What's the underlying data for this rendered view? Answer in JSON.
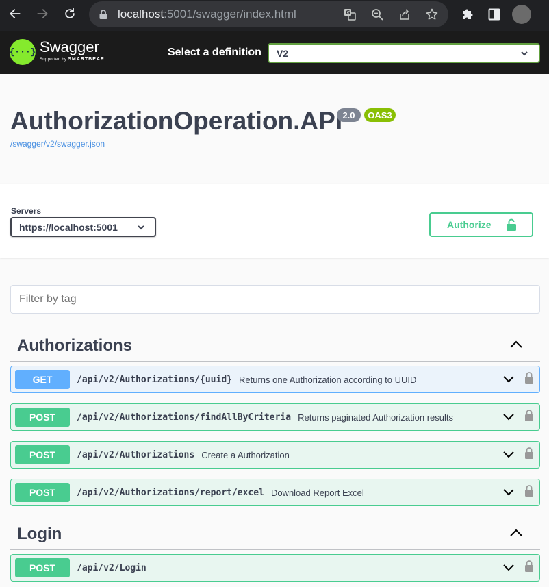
{
  "browser": {
    "url_host": "localhost",
    "url_rest": ":5001/swagger/index.html"
  },
  "topbar": {
    "logo_name": "Swagger",
    "logo_sub_prefix": "Supported by",
    "logo_sub_brand": "SMARTBEAR",
    "logo_symbol": "{···}",
    "definition_label": "Select a definition",
    "definition_value": "V2"
  },
  "info": {
    "title": "AuthorizationOperation.API",
    "version_badge": "2.0",
    "oas_badge": "OAS3",
    "spec_link": "/swagger/v2/swagger.json"
  },
  "scheme": {
    "servers_label": "Servers",
    "servers_value": "https://localhost:5001",
    "authorize_label": "Authorize"
  },
  "filter": {
    "placeholder": "Filter by tag"
  },
  "tags": [
    {
      "name": "Authorizations",
      "operations": [
        {
          "method": "GET",
          "path": "/api/v2/Authorizations/{uuid}",
          "summary": "Returns one Authorization according to UUID"
        },
        {
          "method": "POST",
          "path": "/api/v2/Authorizations/findAllByCriteria",
          "summary": "Returns paginated Authorization results"
        },
        {
          "method": "POST",
          "path": "/api/v2/Authorizations",
          "summary": "Create a Authorization"
        },
        {
          "method": "POST",
          "path": "/api/v2/Authorizations/report/excel",
          "summary": "Download Report Excel"
        }
      ]
    },
    {
      "name": "Login",
      "operations": [
        {
          "method": "POST",
          "path": "/api/v2/Login",
          "summary": ""
        }
      ]
    }
  ],
  "colors": {
    "get": "#61affe",
    "post": "#49cc90",
    "topbar": "#1b1b1b",
    "logo_green": "#85ea2d"
  }
}
